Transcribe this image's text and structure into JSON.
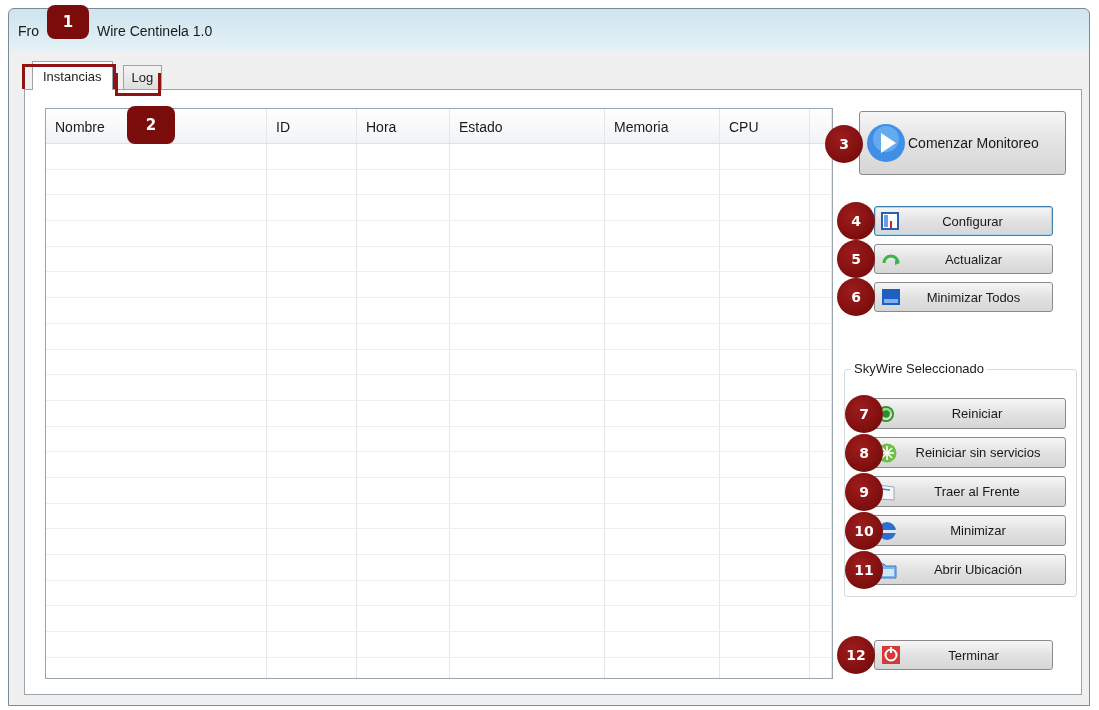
{
  "window": {
    "title_parts": [
      "Fro",
      "Wire Centinela 1.0"
    ]
  },
  "tabs": [
    {
      "label": "Instancias",
      "selected": true,
      "callout": "1"
    },
    {
      "label": "Log",
      "selected": false,
      "callout": "2"
    }
  ],
  "table": {
    "columns": [
      "Nombre",
      "ID",
      "Hora",
      "Estado",
      "Memoria",
      "CPU"
    ]
  },
  "main_button": {
    "label": "Comenzar Monitoreo",
    "callout": "3",
    "focused": false
  },
  "buttons": [
    {
      "label": "Configurar",
      "callout": "4",
      "focused": true
    },
    {
      "label": "Actualizar",
      "callout": "5",
      "focused": false
    },
    {
      "label": "Minimizar Todos",
      "callout": "6",
      "focused": false
    }
  ],
  "group": {
    "title": "SkyWire Seleccionado",
    "buttons": [
      {
        "label": "Reiniciar",
        "callout": "7",
        "focused": false
      },
      {
        "label": "Reiniciar sin servicios",
        "callout": "8",
        "focused": false
      },
      {
        "label": "Traer al Frente",
        "callout": "9",
        "focused": false
      },
      {
        "label": "Minimizar",
        "callout": "10",
        "focused": false
      },
      {
        "label": "Abrir Ubicación",
        "callout": "11",
        "focused": false
      }
    ]
  },
  "bottom_button": {
    "label": "Terminar",
    "callout": "12",
    "focused": false
  }
}
